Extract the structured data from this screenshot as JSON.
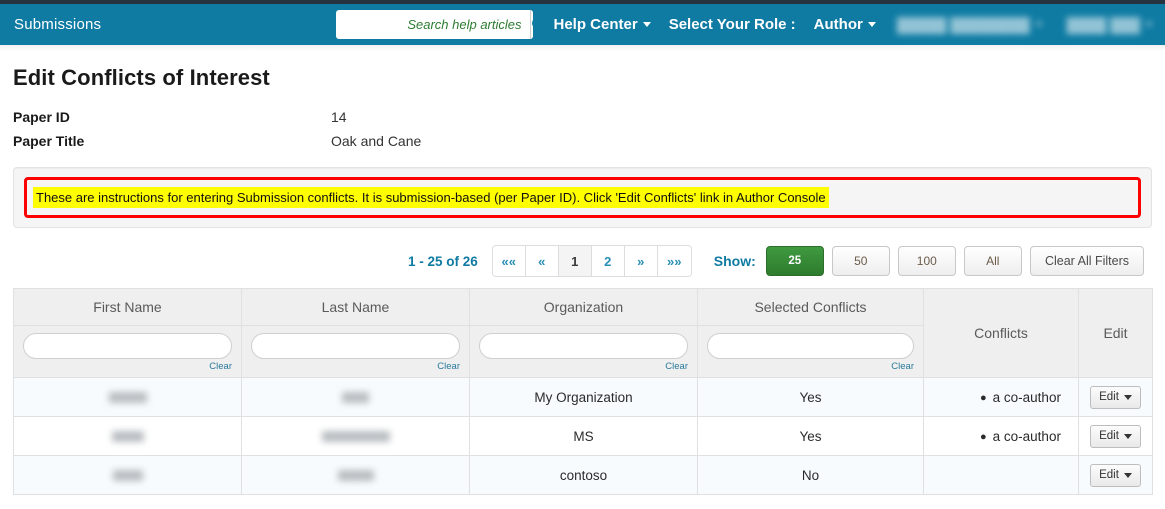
{
  "nav": {
    "brand": "Submissions",
    "search": {
      "placeholder": "Search help articles",
      "value": "",
      "icon": "search-icon"
    },
    "help_center": "Help Center",
    "select_role_label": "Select Your Role :",
    "role_value": "Author",
    "redacted_item_1": "█████ ████████",
    "redacted_item_2": "████ ███"
  },
  "page": {
    "title": "Edit Conflicts of Interest",
    "paper_id_label": "Paper ID",
    "paper_id_value": "14",
    "paper_title_label": "Paper Title",
    "paper_title_value": "Oak and Cane"
  },
  "instructions": {
    "text": "These are instructions for entering Submission conflicts. It is submission-based (per Paper ID). Click 'Edit Conflicts' link in Author Console"
  },
  "toolbar": {
    "range": "1 - 25 of 26",
    "pager": [
      {
        "label": "««",
        "name": "first-page",
        "active": false
      },
      {
        "label": "«",
        "name": "prev-page",
        "active": false
      },
      {
        "label": "1",
        "name": "page-1",
        "active": true
      },
      {
        "label": "2",
        "name": "page-2",
        "active": false
      },
      {
        "label": "»",
        "name": "next-page",
        "active": false
      },
      {
        "label": "»»",
        "name": "last-page",
        "active": false
      }
    ],
    "show_label": "Show:",
    "show_options": [
      "25",
      "50",
      "100",
      "All"
    ],
    "show_selected": "25",
    "clear_all_filters": "Clear All Filters"
  },
  "table": {
    "columns": [
      "First Name",
      "Last Name",
      "Organization",
      "Selected Conflicts",
      "Conflicts",
      "Edit"
    ],
    "clear_label": "Clear",
    "filters": {
      "first_name": "",
      "last_name": "",
      "organization": "",
      "selected_conflicts": ""
    },
    "rows": [
      {
        "first_name": "",
        "last_name": "",
        "organization": "My Organization",
        "selected_conflicts": "Yes",
        "conflicts": "a co-author",
        "edit": "Edit"
      },
      {
        "first_name": "",
        "last_name": "",
        "organization": "MS",
        "selected_conflicts": "Yes",
        "conflicts": "a co-author",
        "edit": "Edit"
      },
      {
        "first_name": "",
        "last_name": "",
        "organization": "contoso",
        "selected_conflicts": "No",
        "conflicts": "",
        "edit": "Edit"
      }
    ]
  },
  "colors": {
    "navbar": "#0f7ba3",
    "top_strip": "#27343f",
    "accent_link": "#2a8fb5",
    "active_green": "#2e7b2e",
    "highlight": "#ffff00",
    "alert_border": "#ff0000"
  }
}
